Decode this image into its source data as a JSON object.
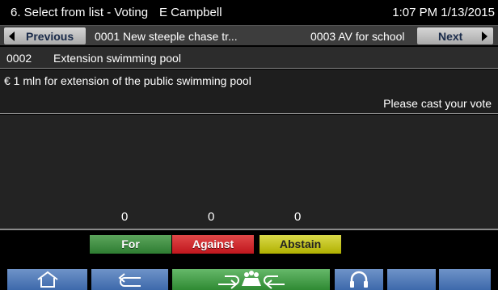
{
  "titlebar": {
    "screen": "6. Select from list - Voting",
    "user": "E Campbell",
    "datetime": "1:07 PM 1/13/2015"
  },
  "nav": {
    "previous_label": "Previous",
    "previous_item": "0001 New steeple chase tr...",
    "next_item": "0003 AV for school",
    "next_label": "Next"
  },
  "item": {
    "number": "0002",
    "name": "Extension swimming pool"
  },
  "description": "€ 1 mln for extension of the public swimming pool",
  "prompt": "Please cast your vote",
  "results": {
    "for": "0",
    "against": "0",
    "abstain": "0"
  },
  "votes": {
    "for_label": "For",
    "against_label": "Against",
    "abstain_label": "Abstain"
  },
  "colors": {
    "for": "#2e7d32",
    "against": "#c0161d",
    "abstain": "#b0b000",
    "toolbar": "#3d69ab",
    "toolbar_active": "#2f8a33"
  },
  "toolbar": {
    "icons": [
      "home-icon",
      "back-icon",
      "voting-icon",
      "headphones-icon"
    ]
  }
}
